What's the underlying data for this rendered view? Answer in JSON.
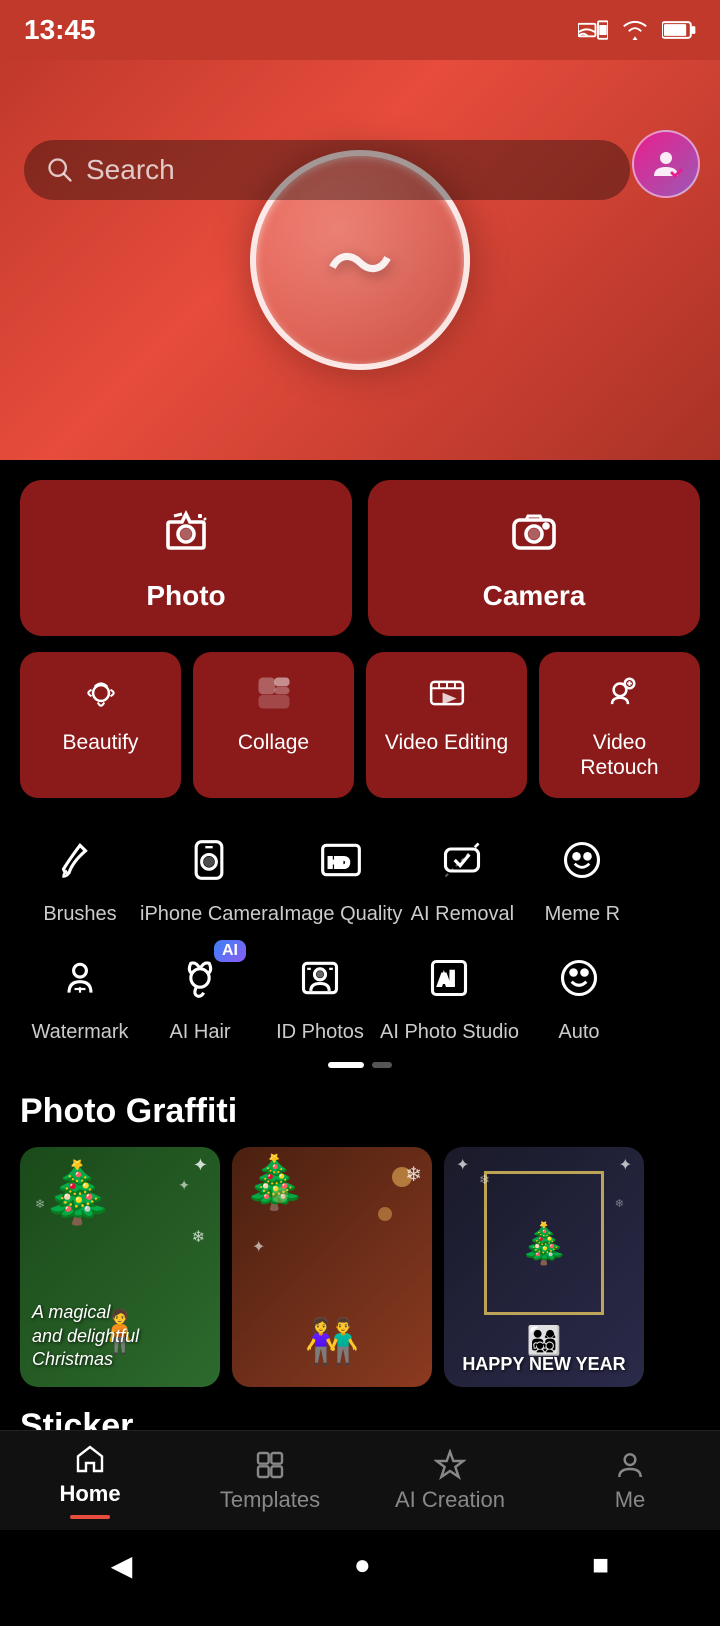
{
  "statusBar": {
    "time": "13:45",
    "icons": [
      "cast",
      "wifi",
      "battery"
    ]
  },
  "searchBar": {
    "placeholder": "Search"
  },
  "hero": {
    "logoText": "〜"
  },
  "bigButtons": [
    {
      "id": "photo",
      "label": "Photo",
      "icon": "✦"
    },
    {
      "id": "camera",
      "label": "Camera",
      "icon": "⊙"
    }
  ],
  "smallButtons": [
    {
      "id": "beautify",
      "label": "Beautify",
      "icon": "♻"
    },
    {
      "id": "collage",
      "label": "Collage",
      "icon": "▣"
    },
    {
      "id": "video-editing",
      "label": "Video Editing",
      "icon": "▶"
    },
    {
      "id": "video-retouch",
      "label": "Video Retouch",
      "icon": "⊕"
    }
  ],
  "toolRow1": [
    {
      "id": "brushes",
      "label": "Brushes",
      "icon": "✏"
    },
    {
      "id": "iphone-camera",
      "label": "iPhone Camera",
      "icon": "◫"
    },
    {
      "id": "image-quality",
      "label": "Image Quality",
      "icon": "HD"
    },
    {
      "id": "ai-removal",
      "label": "AI Removal",
      "icon": "◇"
    },
    {
      "id": "meme",
      "label": "Meme R",
      "icon": "☺"
    }
  ],
  "toolRow2": [
    {
      "id": "watermark",
      "label": "Watermark",
      "icon": "♟"
    },
    {
      "id": "ai-hair",
      "label": "AI Hair",
      "icon": "⚘",
      "badge": "AI"
    },
    {
      "id": "id-photos",
      "label": "ID Photos",
      "icon": "◈"
    },
    {
      "id": "ai-photo-studio",
      "label": "AI Photo Studio",
      "icon": "⊞"
    },
    {
      "id": "auto",
      "label": "Auto",
      "icon": "☻"
    }
  ],
  "photoGraffiti": {
    "title": "Photo Graffiti",
    "items": [
      {
        "id": "xmas1",
        "text1": "A magical",
        "text2": "and delightful",
        "text3": "Christmas"
      },
      {
        "id": "xmas2"
      },
      {
        "id": "xmas3",
        "bottomText": "HAPPY NEW YEAR"
      }
    ]
  },
  "stickerSection": {
    "title": "Sticker"
  },
  "bottomNav": {
    "items": [
      {
        "id": "home",
        "label": "Home",
        "active": true
      },
      {
        "id": "templates",
        "label": "Templates",
        "active": false
      },
      {
        "id": "ai-creation",
        "label": "AI Creation",
        "active": false
      },
      {
        "id": "me",
        "label": "Me",
        "active": false
      }
    ]
  },
  "androidNav": {
    "back": "◀",
    "home": "●",
    "recent": "■"
  }
}
